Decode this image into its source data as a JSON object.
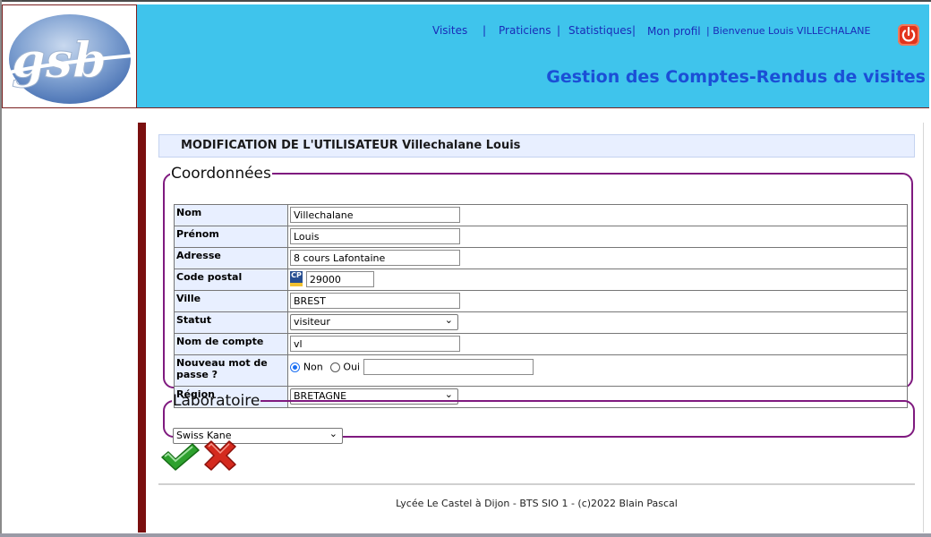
{
  "app": {
    "logo_text": "gsb",
    "page_title": "Gestion des Comptes-Rendus de visites"
  },
  "nav": {
    "visites": "Visites",
    "praticiens": "Praticiens",
    "statistiques": "Statistiques",
    "mon_profil": "Mon profil",
    "separator": "|",
    "welcome": "| Bienvenue Louis VILLECHALANE"
  },
  "form": {
    "title": "MODIFICATION DE L'UTILISATEUR Villechalane Louis",
    "coordonnees_legend": "Coordonnées",
    "labels": {
      "nom": "Nom",
      "prenom": "Prénom",
      "adresse": "Adresse",
      "code_postal": "Code postal",
      "ville": "Ville",
      "statut": "Statut",
      "nom_compte": "Nom de compte",
      "nouveau_mdp": "Nouveau mot de passe ?",
      "region": "Région"
    },
    "values": {
      "nom": "Villechalane",
      "prenom": "Louis",
      "adresse": "8 cours Lafontaine",
      "code_postal": "29000",
      "cp_icon_text": "CP",
      "ville": "BREST",
      "statut": "visiteur",
      "nom_compte": "vl",
      "mdp_non": "Non",
      "mdp_oui": "Oui",
      "mdp_selected": "Non",
      "mdp_new": "",
      "region": "BRETAGNE"
    },
    "laboratoire_legend": "Laboratoire",
    "laboratoire": "Swiss Kane"
  },
  "footer": {
    "text": "Lycée Le Castel à Dijon - BTS SIO 1 - (c)2022 Blain Pascal"
  },
  "colors": {
    "header_bg": "#3fc4ec",
    "nav_link": "#1a2bb8",
    "title": "#1b4fd6",
    "fieldset_border": "#7f1a7f",
    "label_bg": "#e8efff",
    "content_bar": "#7a0f0f"
  },
  "icons": {
    "logout": "power-icon",
    "validate": "check-icon",
    "cancel": "cross-icon",
    "postal_code": "postal-code-icon"
  }
}
